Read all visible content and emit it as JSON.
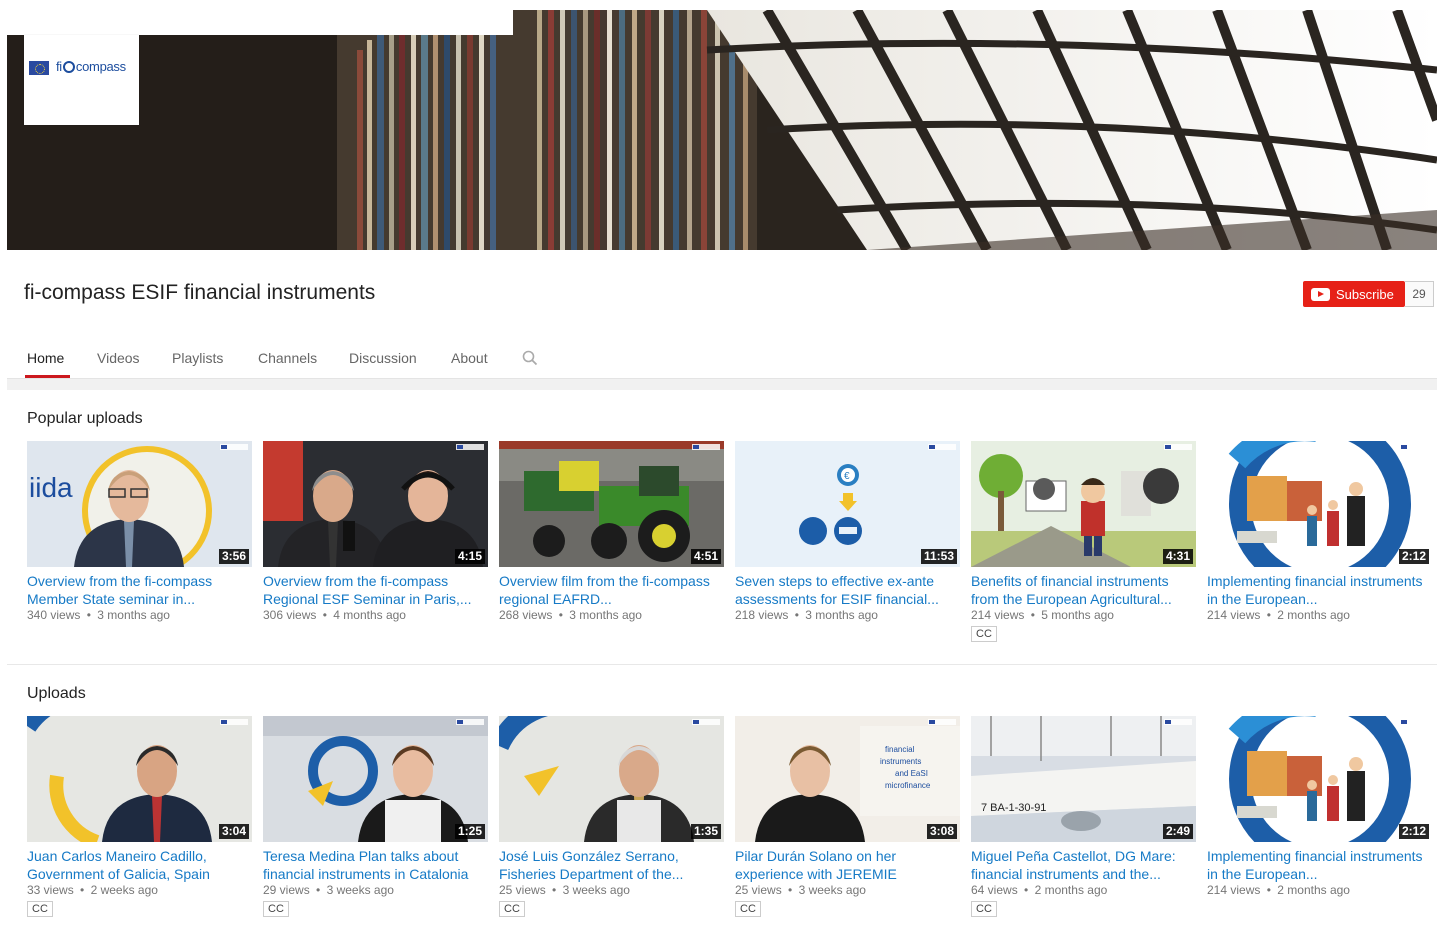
{
  "logo": {
    "brand_prefix": "fi",
    "brand_suffix": "compass"
  },
  "channel": {
    "title": "fi-compass ESIF financial instruments",
    "subscribe_label": "Subscribe",
    "subscriber_count": "29"
  },
  "tabs": [
    {
      "label": "Home",
      "active": true
    },
    {
      "label": "Videos"
    },
    {
      "label": "Playlists"
    },
    {
      "label": "Channels"
    },
    {
      "label": "Discussion"
    },
    {
      "label": "About"
    }
  ],
  "sections": [
    {
      "title": "Popular uploads",
      "videos": [
        {
          "title": "Overview from the fi-compass Member State seminar in...",
          "duration": "3:56",
          "views": "340 views",
          "age": "3 months ago",
          "cc": false,
          "thumb": "speaker-man-glasses"
        },
        {
          "title": "Overview from the fi-compass Regional ESF Seminar in Paris,...",
          "duration": "4:15",
          "views": "306 views",
          "age": "4 months ago",
          "cc": false,
          "thumb": "conference-headphones"
        },
        {
          "title": "Overview film from the fi-compass regional EAFRD...",
          "duration": "4:51",
          "views": "268 views",
          "age": "3 months ago",
          "cc": false,
          "thumb": "tractor"
        },
        {
          "title": "Seven steps to effective ex-ante assessments for ESIF financial...",
          "duration": "11:53",
          "views": "218 views",
          "age": "3 months ago",
          "cc": false,
          "thumb": "euro-diagram"
        },
        {
          "title": "Benefits of financial instruments from the European Agricultural...",
          "duration": "4:31",
          "views": "214 views",
          "age": "5 months ago",
          "cc": true,
          "thumb": "farmer-animation"
        },
        {
          "title": "Implementing financial instruments in the European...",
          "duration": "2:12",
          "views": "214 views",
          "age": "2 months ago",
          "cc": false,
          "thumb": "town-animation"
        }
      ]
    },
    {
      "title": "Uploads",
      "videos": [
        {
          "title": "Juan Carlos Maneiro Cadillo, Government of Galicia, Spain",
          "duration": "3:04",
          "views": "33 views",
          "age": "2 weeks ago",
          "cc": true,
          "thumb": "interview-man-1"
        },
        {
          "title": "Teresa Medina Plan talks about financial instruments in Catalonia",
          "duration": "1:25",
          "views": "29 views",
          "age": "3 weeks ago",
          "cc": true,
          "thumb": "interview-woman-1"
        },
        {
          "title": "José Luis González Serrano, Fisheries Department of the...",
          "duration": "1:35",
          "views": "25 views",
          "age": "3 weeks ago",
          "cc": true,
          "thumb": "interview-man-2"
        },
        {
          "title": "Pilar Durán Solano on her experience with JEREMIE",
          "duration": "3:08",
          "views": "25 views",
          "age": "3 weeks ago",
          "cc": true,
          "thumb": "interview-woman-2"
        },
        {
          "title": "Miguel Peña Castellot, DG Mare: financial instruments and the...",
          "duration": "2:49",
          "views": "64 views",
          "age": "2 months ago",
          "cc": true,
          "thumb": "fishing-boats"
        },
        {
          "title": "Implementing financial instruments in the European...",
          "duration": "2:12",
          "views": "214 views",
          "age": "2 months ago",
          "cc": false,
          "thumb": "town-animation"
        }
      ]
    }
  ],
  "labels": {
    "cc": "CC",
    "meta_separator": "•"
  },
  "icons": {
    "search": "search-icon",
    "subscribe": "youtube-play-icon",
    "logo_flag": "eu-flag-icon"
  },
  "colors": {
    "link": "#167ac6",
    "subscribe": "#e62117",
    "active_tab": "#cc181e"
  }
}
